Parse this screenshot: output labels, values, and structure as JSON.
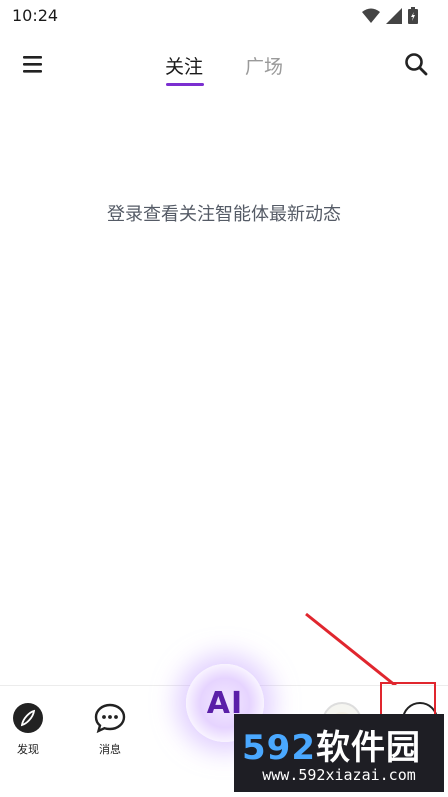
{
  "status_bar": {
    "time": "10:24"
  },
  "top_bar": {
    "tabs": [
      {
        "label": "关注",
        "active": true
      },
      {
        "label": "广场",
        "active": false
      }
    ],
    "accent_color": "#7b2fd0"
  },
  "main": {
    "empty_message": "登录查看关注智能体最新动态"
  },
  "bottom_nav": {
    "items": [
      {
        "label": "发现",
        "icon": "compass-icon"
      },
      {
        "label": "消息",
        "icon": "chat-bubble-icon"
      }
    ],
    "ai_label": "AI"
  },
  "annotation": {
    "box_color": "#e0262e"
  },
  "watermark": {
    "brand_num": "592",
    "brand_cn": "软件园",
    "url": "www.592xiazai.com"
  }
}
